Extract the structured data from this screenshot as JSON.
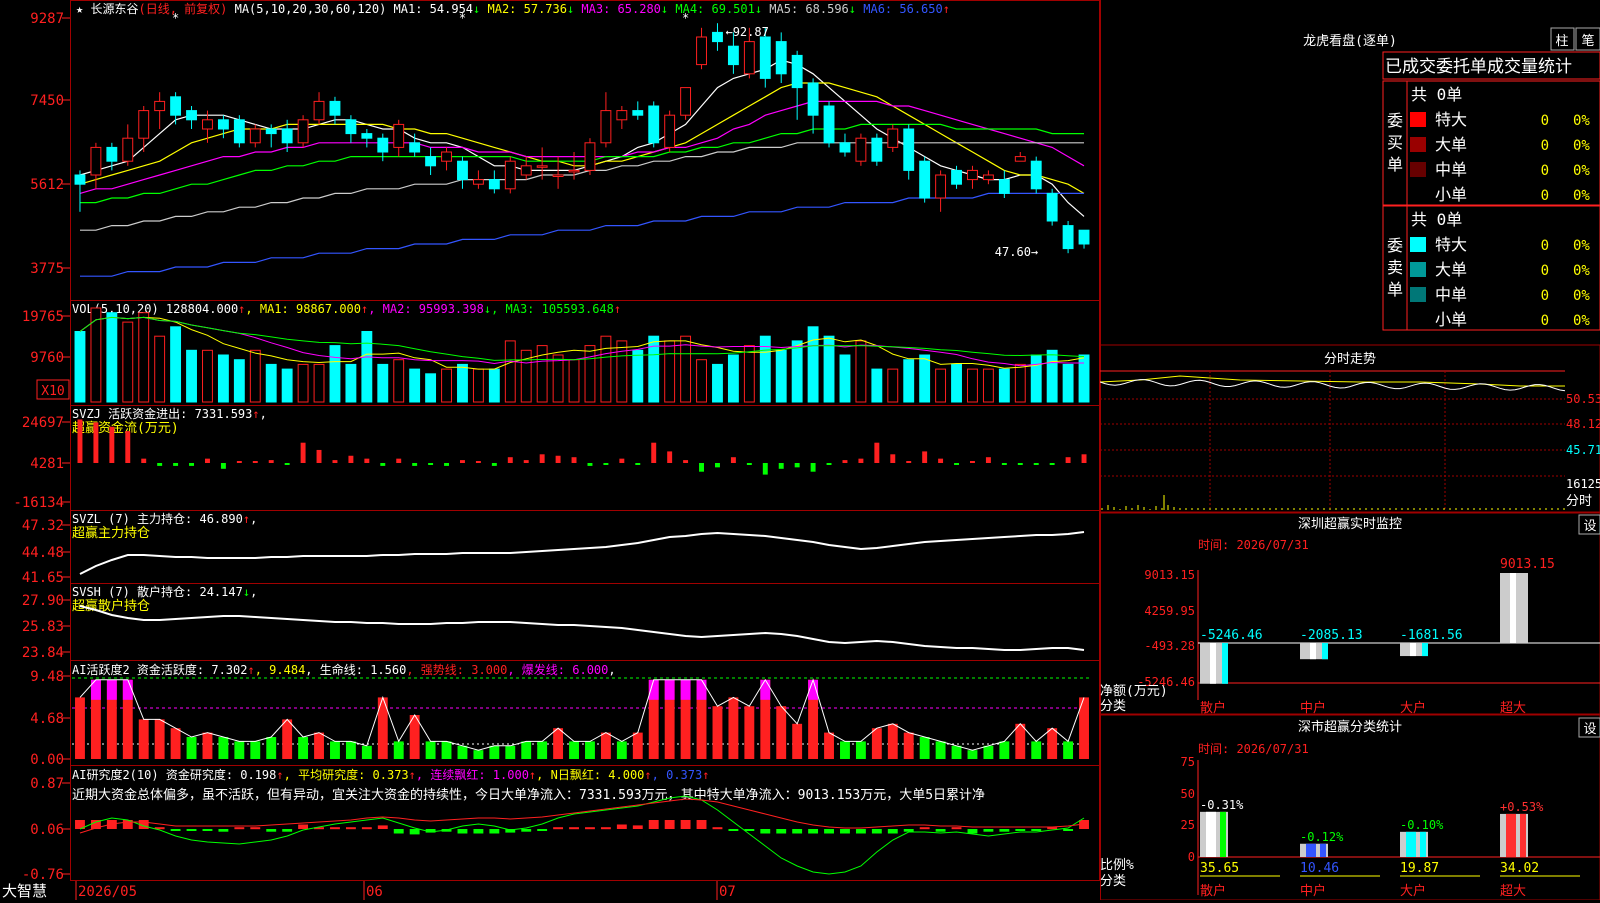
{
  "stock": {
    "name": "长源东谷",
    "period": "(日线, 前复权)",
    "ma_param": "MA(5,10,20,30,60,120)",
    "ma": [
      {
        "name": "MA1",
        "val": "54.954",
        "arrow": "↓",
        "color": "#ffffff"
      },
      {
        "name": "MA2",
        "val": "57.736",
        "arrow": "↓",
        "color": "#ffff00"
      },
      {
        "name": "MA3",
        "val": "65.280",
        "arrow": "↓",
        "color": "#ff00ff"
      },
      {
        "name": "MA4",
        "val": "69.501",
        "arrow": "↓",
        "color": "#00ff00"
      },
      {
        "name": "MA5",
        "val": "68.596",
        "arrow": "↓",
        "color": "#cccccc"
      },
      {
        "name": "MA6",
        "val": "56.650",
        "arrow": "↑",
        "color": "#3355ff"
      }
    ],
    "price_ticks": [
      "9287",
      "7450",
      "5612",
      "3775"
    ],
    "high_label": "92.87",
    "low_label": "47.60"
  },
  "vol": {
    "param": "VOL(5,10,20)",
    "val": "128804.000",
    "arrow": "↑",
    "ma": [
      {
        "name": "MA1",
        "val": "98867.000",
        "arrow": "↑",
        "color": "#ffff00"
      },
      {
        "name": "MA2",
        "val": "95993.398",
        "arrow": "↓",
        "color": "#ff00ff"
      },
      {
        "name": "MA3",
        "val": "105593.648",
        "arrow": "↑",
        "color": "#00ff00"
      }
    ],
    "ticks": [
      "19765",
      "9760"
    ],
    "unit": "X10"
  },
  "svzj": {
    "name": "SVZJ",
    "label": "活跃资金进出:",
    "val": "7331.593",
    "arrow": "↑",
    "sub": "超赢资金流(万元)",
    "ticks": [
      "24697",
      "4281",
      "-16134"
    ]
  },
  "svzl": {
    "name": "SVZL (7)",
    "label": "主力持仓:",
    "val": "46.890",
    "arrow": "↑",
    "sub": "超赢主力持仓",
    "ticks": [
      "47.32",
      "44.48",
      "41.65"
    ]
  },
  "svsh": {
    "name": "SVSH (7)",
    "label": "散户持仓:",
    "val": "24.147",
    "arrow": "↓",
    "sub": "超赢散户持仓",
    "ticks": [
      "27.90",
      "25.83",
      "23.84"
    ]
  },
  "ai1": {
    "name": "AI活跃度2",
    "items": [
      {
        "t": "资金活跃度: 7.302",
        "c": "#ffffff"
      },
      {
        "t": "↑",
        "c": "#ff2020"
      },
      {
        "t": ", 9.484",
        "c": "#ffff00"
      },
      {
        "t": ", 生命线: 1.560",
        "c": "#ffffff"
      },
      {
        "t": ", 强势线: 3.000",
        "c": "#ff2020"
      },
      {
        "t": ", 爆发线: 6.000",
        "c": "#ff00ff"
      },
      {
        "t": ",",
        "c": "#ffffff"
      }
    ],
    "ticks": [
      "9.48",
      "4.68",
      "0.00"
    ]
  },
  "ai2": {
    "name": "AI研究度2(10)",
    "items": [
      {
        "t": "资金研究度: 0.198",
        "c": "#ffffff"
      },
      {
        "t": "↑",
        "c": "#ff2020"
      },
      {
        "t": ", 平均研究度: 0.373",
        "c": "#ffff00"
      },
      {
        "t": "↑",
        "c": "#ff2020"
      },
      {
        "t": ", 连续飘红: 1.000",
        "c": "#ff00ff"
      },
      {
        "t": "↑",
        "c": "#ff2020"
      },
      {
        "t": ", N日飘红: 4.000",
        "c": "#ffff00"
      },
      {
        "t": "↑",
        "c": "#ff2020"
      },
      {
        "t": ", 0.373",
        "c": "#3355ff"
      },
      {
        "t": "↑",
        "c": "#ff2020"
      }
    ],
    "text": "近期大资金总体偏多，虽不活跃，但有异动，宜关注大资金的持续性，今日大单净流入：7331.593万元，其中特大单净流入：9013.153万元，大单5日累计净",
    "ticks": [
      "0.87",
      "0.06",
      "-0.76"
    ]
  },
  "dates": {
    "brand": "大智慧",
    "d1": "2026/05",
    "d2": "06",
    "d3": "07"
  },
  "panel": {
    "title": "龙虎看盘(逐单)",
    "btn1": "柱",
    "btn2": "笔",
    "stat_title": "已成交委托单成交量统计",
    "buy": {
      "side": "委买单",
      "total": "共 0单",
      "rows": [
        {
          "n": "特大",
          "v": "0",
          "p": "0%",
          "c": "#ff0000"
        },
        {
          "n": "大单",
          "v": "0",
          "p": "0%",
          "c": "#990000"
        },
        {
          "n": "中单",
          "v": "0",
          "p": "0%",
          "c": "#660000"
        },
        {
          "n": "小单",
          "v": "0",
          "p": "0%",
          "c": "#000000"
        }
      ]
    },
    "sell": {
      "side": "委卖单",
      "total": "共 0单",
      "rows": [
        {
          "n": "特大",
          "v": "0",
          "p": "0%",
          "c": "#00ffff"
        },
        {
          "n": "大单",
          "v": "0",
          "p": "0%",
          "c": "#009999"
        },
        {
          "n": "中单",
          "v": "0",
          "p": "0%",
          "c": "#007777"
        },
        {
          "n": "小单",
          "v": "0",
          "p": "0%",
          "c": "#000000"
        }
      ]
    }
  },
  "intraday": {
    "title": "分时走势",
    "ticks": [
      "50.53",
      "48.12",
      "45.71",
      "16125"
    ],
    "unit": "分时"
  },
  "monitor": {
    "title": "深圳超赢实时监控",
    "btn": "设",
    "time": "时间: 2026/07/31",
    "ticks": [
      "9013.15",
      "4259.95",
      "-493.28",
      "-5246.46"
    ],
    "ylabel1": "净额(万元)",
    "ylabel2": "分类",
    "bars": [
      {
        "cat": "散户",
        "val": "-5246.46"
      },
      {
        "cat": "中户",
        "val": "-2085.13"
      },
      {
        "cat": "大户",
        "val": "-1681.56"
      },
      {
        "cat": "超大",
        "val": "9013.15"
      }
    ]
  },
  "classify": {
    "title": "深市超赢分类统计",
    "btn": "设",
    "time": "时间: 2026/07/31",
    "ticks": [
      "75",
      "50",
      "25",
      "0"
    ],
    "ylabel1": "比例%",
    "ylabel2": "分类",
    "bars": [
      {
        "cat": "散户",
        "val": "35.65",
        "chg": "-0.31%",
        "c": "#ffffff",
        "cc": "#ffffff"
      },
      {
        "cat": "中户",
        "val": "10.46",
        "chg": "-0.12%",
        "c": "#3355ff",
        "cc": "#00ff00"
      },
      {
        "cat": "大户",
        "val": "19.87",
        "chg": "-0.10%",
        "c": "#00ffff",
        "cc": "#00ff00"
      },
      {
        "cat": "超大",
        "val": "34.02",
        "chg": "+0.53%",
        "c": "#ff3030",
        "cc": "#ff3030"
      }
    ]
  },
  "chart_data": {
    "type": "candlestick",
    "price_range": [
      3775,
      9287
    ],
    "candles": [
      [
        60,
        58,
        61,
        52
      ],
      [
        60,
        66,
        67,
        57
      ],
      [
        66,
        63,
        67,
        61
      ],
      [
        63,
        68,
        71,
        62
      ],
      [
        68,
        74,
        75,
        65
      ],
      [
        74,
        76,
        78,
        70
      ],
      [
        77,
        73,
        78,
        71
      ],
      [
        74,
        72,
        75,
        70
      ],
      [
        70,
        72,
        74,
        67
      ],
      [
        72,
        70,
        73,
        68
      ],
      [
        72,
        67,
        73,
        66
      ],
      [
        67,
        70,
        71,
        66
      ],
      [
        70,
        69,
        71,
        66
      ],
      [
        70,
        67,
        72,
        65
      ],
      [
        67,
        72,
        73,
        66
      ],
      [
        72,
        76,
        78,
        71
      ],
      [
        76,
        73,
        77,
        71
      ],
      [
        72,
        69,
        73,
        67
      ],
      [
        69,
        68,
        70,
        66
      ],
      [
        68,
        65,
        69,
        63
      ],
      [
        66,
        71,
        72,
        64
      ],
      [
        67,
        65,
        69,
        64
      ],
      [
        64,
        62,
        66,
        60
      ],
      [
        63,
        65,
        66,
        61
      ],
      [
        63,
        59,
        64,
        57
      ],
      [
        58,
        59,
        61,
        57
      ],
      [
        59,
        57,
        61,
        56
      ],
      [
        57,
        63,
        64,
        56
      ],
      [
        60,
        62,
        64,
        59
      ],
      [
        62,
        62,
        66,
        59
      ],
      [
        60,
        60,
        64,
        57
      ],
      [
        61,
        61,
        65,
        59
      ],
      [
        61,
        67,
        68,
        60
      ],
      [
        67,
        74,
        78,
        66
      ],
      [
        72,
        74,
        75,
        70
      ],
      [
        74,
        73,
        76,
        72
      ],
      [
        75,
        67,
        76,
        66
      ],
      [
        66,
        73,
        74,
        65
      ],
      [
        73,
        79,
        79,
        72
      ],
      [
        84,
        90,
        92,
        83
      ],
      [
        91,
        89,
        93,
        87
      ],
      [
        88,
        84,
        91,
        82
      ],
      [
        82,
        89,
        92,
        81
      ],
      [
        90,
        81,
        92,
        79
      ],
      [
        89,
        82,
        91,
        80
      ],
      [
        86,
        79,
        87,
        72
      ],
      [
        80,
        73,
        81,
        69
      ],
      [
        75,
        67,
        76,
        66
      ],
      [
        67,
        65,
        69,
        64
      ],
      [
        63,
        68,
        69,
        62
      ],
      [
        68,
        63,
        69,
        62
      ],
      [
        66,
        70,
        71,
        65
      ],
      [
        70,
        61,
        71,
        59
      ],
      [
        63,
        55,
        64,
        54
      ],
      [
        55,
        60,
        61,
        52
      ],
      [
        61,
        58,
        62,
        57
      ],
      [
        59,
        61,
        62,
        57
      ],
      [
        59,
        60,
        61,
        58
      ],
      [
        59,
        56,
        61,
        55
      ],
      [
        63,
        64,
        65,
        63
      ],
      [
        63,
        57,
        64,
        56
      ],
      [
        56,
        50,
        57,
        49
      ],
      [
        49,
        44,
        50,
        43
      ],
      [
        48,
        45,
        48,
        44
      ]
    ],
    "volume": [
      15,
      20,
      19,
      17,
      19,
      14,
      16,
      11,
      11,
      10,
      9,
      11,
      8,
      7,
      8,
      8,
      12,
      8,
      15,
      8,
      9,
      7,
      6,
      7,
      8,
      7,
      7,
      13,
      11,
      12,
      10,
      9,
      12,
      14,
      13,
      11,
      14,
      13,
      14,
      9,
      8,
      10,
      12,
      14,
      11,
      13,
      16,
      14,
      10,
      13,
      7,
      7,
      9,
      10,
      7,
      8,
      7,
      7,
      7,
      8,
      10,
      11,
      8,
      10
    ],
    "ma": {
      "MA1": [
        60,
        61,
        62,
        63,
        66,
        69,
        72,
        73,
        73,
        73,
        72,
        71,
        70,
        70,
        70,
        71,
        72,
        72,
        71,
        70,
        70,
        68,
        67,
        67,
        66,
        64,
        62,
        62,
        61,
        61,
        61,
        61,
        62,
        63,
        64,
        66,
        67,
        69,
        71,
        75,
        79,
        81,
        82,
        83,
        85,
        84,
        82,
        79,
        76,
        73,
        70,
        68,
        66,
        64,
        62,
        61,
        60,
        59,
        59,
        60,
        60,
        58,
        54,
        51
      ],
      "MA2": [
        58,
        59,
        60,
        61,
        62,
        63,
        65,
        67,
        68,
        69,
        70,
        70,
        70,
        71,
        71,
        71,
        71,
        71,
        71,
        71,
        70,
        70,
        69,
        69,
        68,
        67,
        66,
        65,
        64,
        63,
        63,
        62,
        62,
        63,
        63,
        64,
        65,
        66,
        67,
        69,
        71,
        73,
        75,
        77,
        79,
        80,
        80,
        80,
        79,
        78,
        77,
        75,
        73,
        71,
        69,
        67,
        65,
        63,
        61,
        60,
        60,
        59,
        58,
        56
      ],
      "MA3": [
        56,
        57,
        57,
        58,
        59,
        60,
        61,
        62,
        63,
        64,
        64,
        65,
        65,
        66,
        66,
        67,
        67,
        67,
        67,
        67,
        67,
        67,
        66,
        66,
        66,
        65,
        65,
        65,
        64,
        64,
        64,
        64,
        64,
        64,
        64,
        65,
        65,
        66,
        66,
        67,
        68,
        70,
        71,
        73,
        74,
        75,
        76,
        76,
        76,
        76,
        76,
        75,
        75,
        74,
        73,
        72,
        71,
        70,
        69,
        68,
        67,
        66,
        64,
        62
      ],
      "MA4": [
        54,
        54,
        55,
        55,
        56,
        56,
        57,
        58,
        58,
        59,
        60,
        61,
        61,
        62,
        62,
        63,
        63,
        64,
        64,
        64,
        64,
        64,
        64,
        64,
        64,
        64,
        64,
        64,
        63,
        63,
        63,
        63,
        63,
        64,
        64,
        64,
        64,
        65,
        65,
        66,
        66,
        67,
        67,
        68,
        69,
        69,
        70,
        70,
        70,
        71,
        71,
        71,
        71,
        71,
        71,
        70,
        70,
        70,
        70,
        70,
        70,
        69,
        69,
        69
      ],
      "MA5": [
        48,
        48,
        49,
        49,
        50,
        50,
        51,
        51,
        52,
        52,
        53,
        53,
        54,
        54,
        55,
        55,
        56,
        56,
        57,
        57,
        57,
        58,
        58,
        58,
        59,
        59,
        59,
        59,
        59,
        60,
        60,
        60,
        61,
        61,
        62,
        62,
        63,
        63,
        64,
        64,
        65,
        65,
        66,
        66,
        66,
        67,
        67,
        67,
        67,
        67,
        67,
        67,
        67,
        67,
        67,
        67,
        67,
        67,
        67,
        67,
        67,
        67,
        67,
        67
      ],
      "MA6": [
        38,
        38,
        38,
        39,
        39,
        39,
        40,
        40,
        40,
        41,
        41,
        41,
        42,
        42,
        42,
        43,
        43,
        43,
        44,
        44,
        44,
        45,
        45,
        45,
        46,
        46,
        46,
        47,
        47,
        47,
        48,
        48,
        48,
        49,
        49,
        49,
        50,
        50,
        50,
        51,
        51,
        51,
        52,
        52,
        52,
        53,
        53,
        53,
        54,
        54,
        54,
        54,
        55,
        55,
        55,
        55,
        55,
        56,
        56,
        56,
        56,
        56,
        56,
        56
      ]
    }
  }
}
